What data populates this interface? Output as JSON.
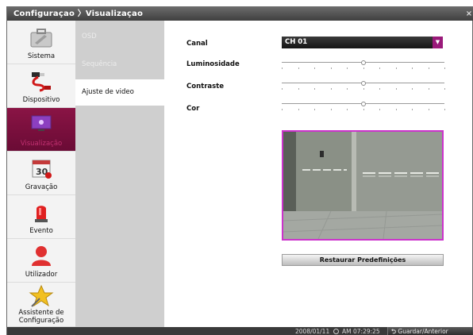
{
  "window": {
    "breadcrumb": "Configuraçao 〉Visualizaçao",
    "close_symbol": "×"
  },
  "nav": {
    "items": [
      {
        "label": "Sistema",
        "icon": "toolbox-icon"
      },
      {
        "label": "Dispositivo",
        "icon": "cable-plug-icon"
      },
      {
        "label": "Visualização",
        "icon": "monitor-icon"
      },
      {
        "label": "Gravação",
        "icon": "calendar-icon"
      },
      {
        "label": "Evento",
        "icon": "alarm-light-icon"
      },
      {
        "label": "Utilizador",
        "icon": "user-icon"
      },
      {
        "label": "Assistente de Configuração",
        "icon": "star-wizard-icon"
      }
    ],
    "active_index": 2
  },
  "submenu": {
    "items": [
      "OSD",
      "Sequência",
      "Ajuste de video"
    ],
    "active_index": 2
  },
  "settings": {
    "canal_label": "Canal",
    "canal_value": "CH 01",
    "luminosidade_label": "Luminosidade",
    "luminosidade_value": 0.5,
    "contraste_label": "Contraste",
    "contraste_value": 0.5,
    "cor_label": "Cor",
    "cor_value": 0.5
  },
  "reset_button": "Restaurar Predefinições",
  "status": {
    "date": "2008/01/11",
    "time": "AM 07:29:25",
    "save_button": "Guardar/Anterior"
  },
  "colors": {
    "accent": "#9a1a7a",
    "preview_border": "#cc33cc",
    "nav_active": "#7a0f3d"
  }
}
